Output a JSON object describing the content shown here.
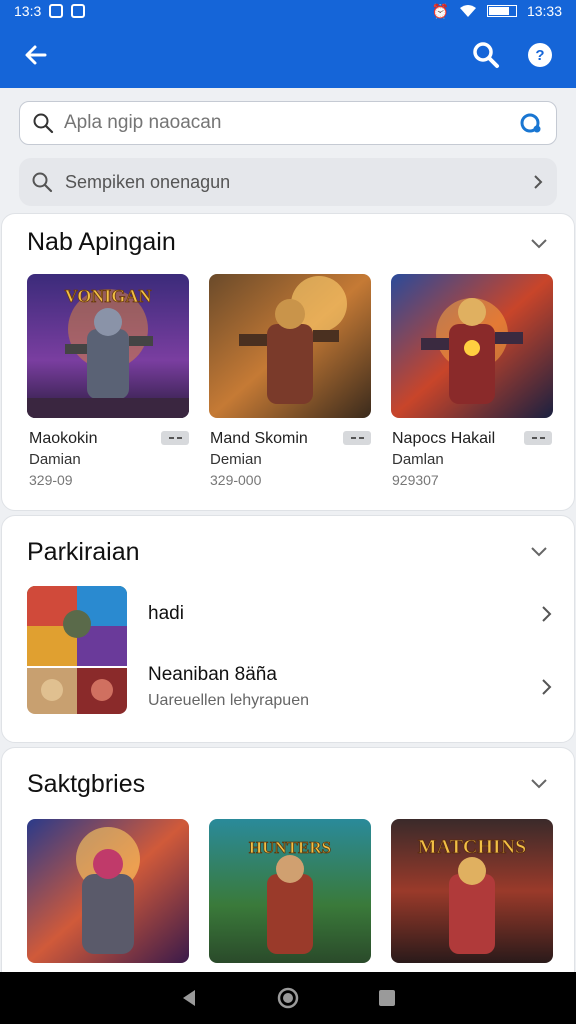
{
  "status_bar": {
    "time_left": "13:3",
    "time_right": "13:33"
  },
  "search": {
    "placeholder": "Apla ngip naoacan"
  },
  "filter": {
    "label": "Sempiken onenagun"
  },
  "sections": {
    "featured": {
      "title": "Nab Apingain",
      "games": [
        {
          "name": "Maokokin",
          "sub": "Damian",
          "meta": "329-09",
          "banner": "VONIGAN"
        },
        {
          "name": "Mand Skomin",
          "sub": "Demian",
          "meta": "329-000",
          "banner": ""
        },
        {
          "name": "Napocs Hakail",
          "sub": "Damlan",
          "meta": "929307",
          "banner": ""
        }
      ]
    },
    "partners": {
      "title": "Parkiraian",
      "rows": [
        {
          "title": "hadi",
          "subtitle": ""
        },
        {
          "title": "Neaniban 8äña",
          "subtitle": "Uareuellen lehyrapuen"
        }
      ]
    },
    "categories": {
      "title": "Saktgbries",
      "games": [
        {
          "banner": ""
        },
        {
          "banner": "HUNTERS"
        },
        {
          "banner": "MATCHINS"
        }
      ]
    }
  },
  "colors": {
    "primary": "#1565d8",
    "background": "#eef0f3"
  }
}
